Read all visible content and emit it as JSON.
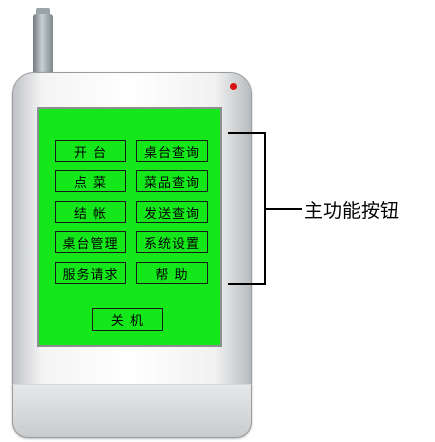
{
  "screen": {
    "buttons": [
      {
        "label": "开 台"
      },
      {
        "label": "桌台查询"
      },
      {
        "label": "点 菜"
      },
      {
        "label": "菜品查询"
      },
      {
        "label": "结 帐"
      },
      {
        "label": "发送查询"
      },
      {
        "label": "桌台管理"
      },
      {
        "label": "系统设置"
      },
      {
        "label": "服务请求"
      },
      {
        "label": "帮 助"
      }
    ],
    "shutdown": {
      "label": "关 机"
    }
  },
  "callout": {
    "label": "主功能按钮"
  },
  "colors": {
    "screen": "#14e81a",
    "led": "#d81010"
  }
}
